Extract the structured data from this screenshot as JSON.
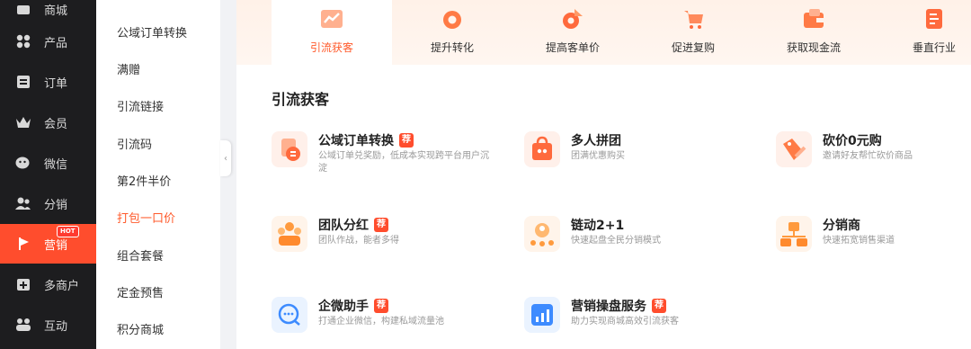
{
  "nav": {
    "items": [
      {
        "label": "商城",
        "icon": "store-icon"
      },
      {
        "label": "产品",
        "icon": "grid-icon"
      },
      {
        "label": "订单",
        "icon": "order-icon"
      },
      {
        "label": "会员",
        "icon": "crown-icon"
      },
      {
        "label": "微信",
        "icon": "wechat-icon"
      },
      {
        "label": "分销",
        "icon": "users-icon"
      },
      {
        "label": "营销",
        "icon": "flag-icon",
        "badge": "HOT"
      },
      {
        "label": "多商户",
        "icon": "shop-plus-icon"
      },
      {
        "label": "互动",
        "icon": "chat-icon"
      }
    ]
  },
  "submenu": {
    "items": [
      "公域订单转换",
      "满赠",
      "引流链接",
      "引流码",
      "第2件半价",
      "打包一口价",
      "组合套餐",
      "定金预售",
      "积分商城"
    ]
  },
  "tabs": [
    "引流获客",
    "提升转化",
    "提高客单价",
    "促进复购",
    "获取现金流",
    "垂直行业"
  ],
  "section": {
    "title": "引流获客",
    "badge_label": "荐",
    "cards": [
      {
        "title": "公域订单转换",
        "desc": "公域订单兑奖励，低成本实现跨平台用户沉淀",
        "recommended": true,
        "icon": "order-convert-icon"
      },
      {
        "title": "多人拼团",
        "desc": "团满优惠购买",
        "recommended": false,
        "icon": "group-buy-icon"
      },
      {
        "title": "砍价0元购",
        "desc": "邀请好友帮忙砍价商品",
        "recommended": false,
        "icon": "bargain-icon"
      },
      {
        "title": "团队分红",
        "desc": "团队作战，能者多得",
        "recommended": true,
        "icon": "team-icon"
      },
      {
        "title": "链动2+1",
        "desc": "快速起盘全民分销模式",
        "recommended": false,
        "icon": "chain-icon"
      },
      {
        "title": "分销商",
        "desc": "快速拓宽销售渠道",
        "recommended": false,
        "icon": "distributor-icon"
      },
      {
        "title": "企微助手",
        "desc": "打通企业微信，构建私域流量池",
        "recommended": true,
        "icon": "wecom-icon"
      },
      {
        "title": "营销操盘服务",
        "desc": "助力实现商城高效引流获客",
        "recommended": true,
        "icon": "chart-icon"
      }
    ]
  },
  "colors": {
    "accent": "#ff5a2b",
    "nav_bg": "#1d1d1f",
    "active_nav": "#ff4d2d"
  }
}
